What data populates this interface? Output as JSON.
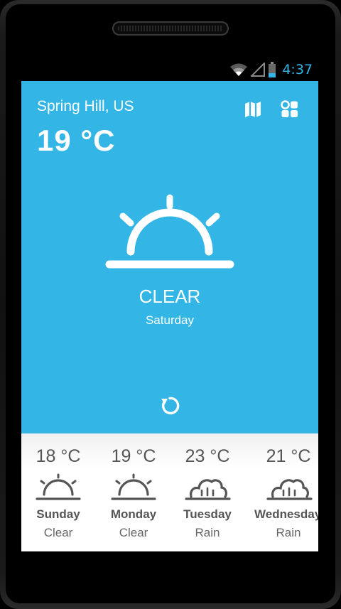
{
  "status": {
    "time": "4:37",
    "accent_color": "#33b5e5"
  },
  "current": {
    "city": "Spring Hill, US",
    "temperature": "19 °C",
    "condition": "CLEAR",
    "day": "Saturday",
    "icon": "sun-rising-icon",
    "background_color": "#33b5e5"
  },
  "actions": {
    "map_icon": "map-icon",
    "grid_icon": "grid-icon",
    "refresh_icon": "refresh-icon"
  },
  "forecast": [
    {
      "temperature": "18 °C",
      "day": "Sunday",
      "condition": "Clear",
      "icon": "sun-rising-icon"
    },
    {
      "temperature": "19 °C",
      "day": "Monday",
      "condition": "Clear",
      "icon": "sun-rising-icon"
    },
    {
      "temperature": "23 °C",
      "day": "Tuesday",
      "condition": "Rain",
      "icon": "cloud-rain-icon"
    },
    {
      "temperature": "21 °C",
      "day": "Wednesday",
      "condition": "Rain",
      "icon": "cloud-rain-icon"
    }
  ]
}
